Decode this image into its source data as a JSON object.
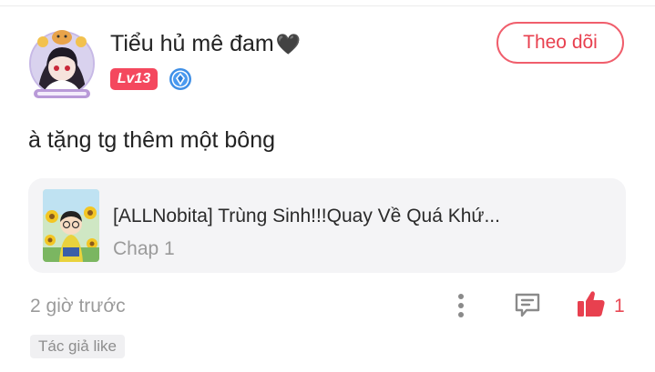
{
  "comment": {
    "user": {
      "name": "Tiểu hủ mê đam",
      "name_emoji": "🖤",
      "level": "Lv13"
    },
    "follow_label": "Theo dõi",
    "text": "à tặng tg thêm một bông",
    "story": {
      "title": "[ALLNobita] Trùng Sinh!!!Quay Về Quá Khứ...",
      "chapter": "Chap 1"
    },
    "time": "2 giờ trước",
    "like_count": "1",
    "author_tag": "Tác giả like"
  },
  "colors": {
    "accent": "#e8404f",
    "level_badge": "#f4485e",
    "card_bg": "#f4f4f6"
  },
  "icons": {
    "more": "more-vertical-icon",
    "reply": "reply-icon",
    "like": "thumbs-up-icon",
    "vip": "diamond-badge-icon"
  }
}
